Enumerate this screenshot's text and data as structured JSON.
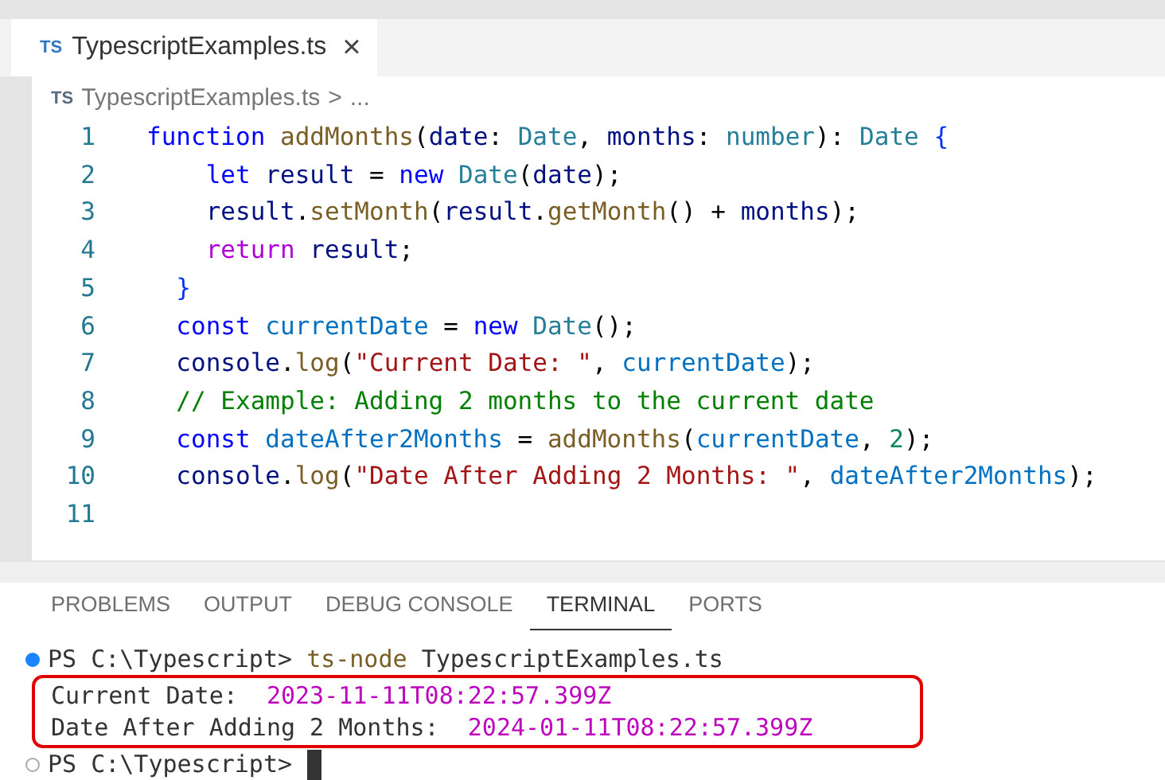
{
  "tab": {
    "icon_text": "TS",
    "title": "TypescriptExamples.ts",
    "close": "×",
    "selected": true
  },
  "breadcrumb": {
    "icon_text": "TS",
    "file": "TypescriptExamples.ts",
    "separator": ">",
    "more": "..."
  },
  "code_lines": [
    {
      "number": "1",
      "tokens": [
        {
          "text": "function ",
          "kind": "keyword"
        },
        {
          "text": "addMonths",
          "kind": "function"
        },
        {
          "text": "(",
          "kind": "plain"
        },
        {
          "text": "date",
          "kind": "param"
        },
        {
          "text": ": ",
          "kind": "plain"
        },
        {
          "text": "Date",
          "kind": "type"
        },
        {
          "text": ", ",
          "kind": "plain"
        },
        {
          "text": "months",
          "kind": "param"
        },
        {
          "text": ": ",
          "kind": "plain"
        },
        {
          "text": "number",
          "kind": "type"
        },
        {
          "text": ")",
          "kind": "plain"
        },
        {
          "text": ": ",
          "kind": "plain"
        },
        {
          "text": "Date",
          "kind": "type"
        },
        {
          "text": " {",
          "kind": "bracket"
        }
      ]
    },
    {
      "number": "2",
      "tokens": [
        {
          "text": "    let ",
          "kind": "keyword"
        },
        {
          "text": "result",
          "kind": "param"
        },
        {
          "text": " = ",
          "kind": "plain"
        },
        {
          "text": "new ",
          "kind": "keyword"
        },
        {
          "text": "Date",
          "kind": "type"
        },
        {
          "text": "(",
          "kind": "plain"
        },
        {
          "text": "date",
          "kind": "param"
        },
        {
          "text": ");",
          "kind": "plain"
        }
      ]
    },
    {
      "number": "3",
      "tokens": [
        {
          "text": "    result",
          "kind": "param"
        },
        {
          "text": ".",
          "kind": "plain"
        },
        {
          "text": "setMonth",
          "kind": "function"
        },
        {
          "text": "(",
          "kind": "plain"
        },
        {
          "text": "result",
          "kind": "param"
        },
        {
          "text": ".",
          "kind": "plain"
        },
        {
          "text": "getMonth",
          "kind": "function"
        },
        {
          "text": "() + ",
          "kind": "plain"
        },
        {
          "text": "months",
          "kind": "param"
        },
        {
          "text": ");",
          "kind": "plain"
        }
      ]
    },
    {
      "number": "4",
      "tokens": [
        {
          "text": "    return ",
          "kind": "control"
        },
        {
          "text": "result",
          "kind": "param"
        },
        {
          "text": ";",
          "kind": "plain"
        }
      ]
    },
    {
      "number": "5",
      "tokens": [
        {
          "text": "  }",
          "kind": "bracket"
        }
      ]
    },
    {
      "number": "6",
      "tokens": [
        {
          "text": "  const ",
          "kind": "keyword"
        },
        {
          "text": "currentDate",
          "kind": "constant"
        },
        {
          "text": " = ",
          "kind": "plain"
        },
        {
          "text": "new ",
          "kind": "keyword"
        },
        {
          "text": "Date",
          "kind": "type"
        },
        {
          "text": "();",
          "kind": "plain"
        }
      ]
    },
    {
      "number": "7",
      "tokens": [
        {
          "text": "  console",
          "kind": "param"
        },
        {
          "text": ".",
          "kind": "plain"
        },
        {
          "text": "log",
          "kind": "function"
        },
        {
          "text": "(",
          "kind": "plain"
        },
        {
          "text": "\"Current Date: \"",
          "kind": "string"
        },
        {
          "text": ", ",
          "kind": "plain"
        },
        {
          "text": "currentDate",
          "kind": "constant"
        },
        {
          "text": ");",
          "kind": "plain"
        }
      ]
    },
    {
      "number": "8",
      "tokens": [
        {
          "text": "  // Example: Adding 2 months to the current date",
          "kind": "comment"
        }
      ]
    },
    {
      "number": "9",
      "tokens": [
        {
          "text": "  const ",
          "kind": "keyword"
        },
        {
          "text": "dateAfter2Months",
          "kind": "constant"
        },
        {
          "text": " = ",
          "kind": "plain"
        },
        {
          "text": "addMonths",
          "kind": "function"
        },
        {
          "text": "(",
          "kind": "plain"
        },
        {
          "text": "currentDate",
          "kind": "constant"
        },
        {
          "text": ", ",
          "kind": "plain"
        },
        {
          "text": "2",
          "kind": "number"
        },
        {
          "text": ");",
          "kind": "plain"
        }
      ]
    },
    {
      "number": "10",
      "tokens": [
        {
          "text": "  console",
          "kind": "param"
        },
        {
          "text": ".",
          "kind": "plain"
        },
        {
          "text": "log",
          "kind": "function"
        },
        {
          "text": "(",
          "kind": "plain"
        },
        {
          "text": "\"Date After Adding 2 Months: \"",
          "kind": "string"
        },
        {
          "text": ", ",
          "kind": "plain"
        },
        {
          "text": "dateAfter2Months",
          "kind": "constant"
        },
        {
          "text": ");",
          "kind": "plain"
        }
      ]
    },
    {
      "number": "11"
    }
  ],
  "panel_tabs": [
    {
      "label": "PROBLEMS",
      "selected": false
    },
    {
      "label": "OUTPUT",
      "selected": false
    },
    {
      "label": "DEBUG CONSOLE",
      "selected": false
    },
    {
      "label": "TERMINAL",
      "selected": true
    },
    {
      "label": "PORTS",
      "selected": false
    }
  ],
  "terminal": {
    "command": {
      "succeeded": true,
      "prompt": "PS C:\\Typescript>",
      "program": "ts-node",
      "args": "TypescriptExamples.ts"
    },
    "output": [
      {
        "label": "Current Date:  ",
        "value": "2023-11-11T08:22:57.399Z"
      },
      {
        "label": "Date After Adding 2 Months:  ",
        "value": "2024-01-11T08:22:57.399Z"
      }
    ],
    "prompt": {
      "succeeded": false,
      "prompt": "PS C:\\Typescript>"
    }
  }
}
